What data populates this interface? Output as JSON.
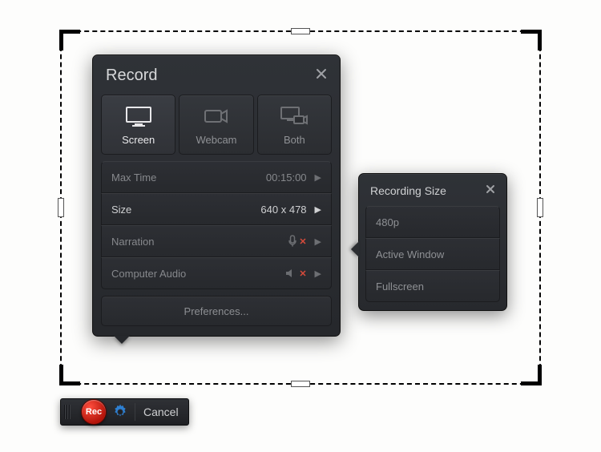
{
  "panel": {
    "title": "Record",
    "modes": {
      "screen": "Screen",
      "webcam": "Webcam",
      "both": "Both"
    },
    "rows": {
      "maxtime_label": "Max Time",
      "maxtime_value": "00:15:00",
      "size_label": "Size",
      "size_value": "640 x 478",
      "narration_label": "Narration",
      "audio_label": "Computer Audio"
    },
    "prefs": "Preferences..."
  },
  "sizep": {
    "title": "Recording Size",
    "opt1": "480p",
    "opt2": "Active Window",
    "opt3": "Fullscreen"
  },
  "toolbar": {
    "rec": "Rec",
    "cancel": "Cancel"
  }
}
